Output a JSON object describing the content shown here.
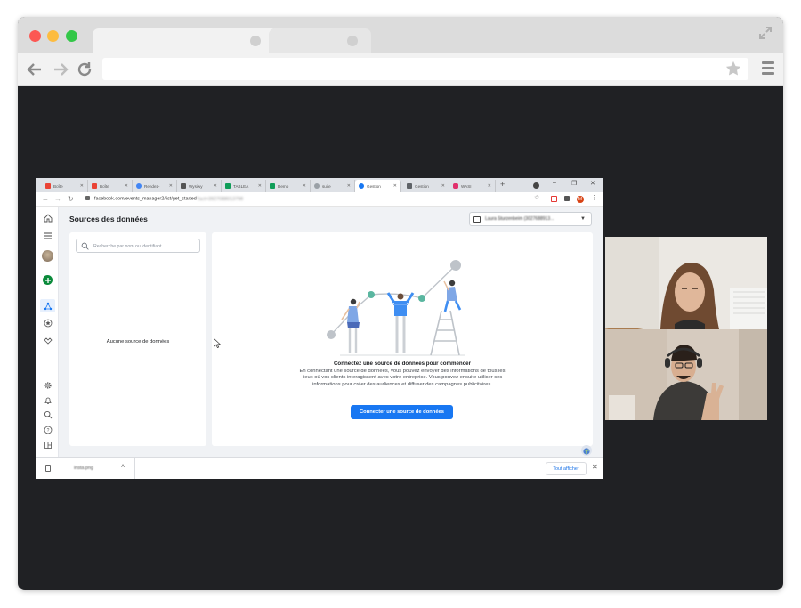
{
  "inner_browser": {
    "tabs": [
      {
        "label": "Boîte",
        "favicon": "gmail-icon",
        "color": "#ea4335",
        "active": false
      },
      {
        "label": "Boîte",
        "favicon": "gmail-icon",
        "color": "#ea4335",
        "active": false
      },
      {
        "label": "Rendez-",
        "favicon": "calendar-icon",
        "color": "#4285f4",
        "active": false
      },
      {
        "label": "Wysiwy",
        "favicon": "doc-icon",
        "color": "#555555",
        "active": false
      },
      {
        "label": "TABLEA",
        "favicon": "drive-icon",
        "color": "#0f9d58",
        "active": false
      },
      {
        "label": "Demo",
        "favicon": "sheet-icon",
        "color": "#0f9d58",
        "active": false
      },
      {
        "label": "suite",
        "favicon": "globe-icon",
        "color": "#9aa0a6",
        "active": false
      },
      {
        "label": "Gestion",
        "favicon": "facebook-icon",
        "color": "#1877f2",
        "active": true
      },
      {
        "label": "Gestion",
        "favicon": "window-icon",
        "color": "#5f6368",
        "active": false
      },
      {
        "label": "WASI",
        "favicon": "instagram-icon",
        "color": "#e1306c",
        "active": false
      }
    ],
    "new_tab": "+",
    "url_visible": "facebook.com/events_manager2/list/get_started",
    "url_blurred": "?act=3927088013798"
  },
  "page": {
    "title": "Sources des données",
    "account_blurred": "Laura Sturzenbeim (3027688913…",
    "search_placeholder": "Recherche par nom ou identifiant",
    "empty_sources": "Aucune source de données",
    "heading": "Connectez une source de données pour commencer",
    "body": "En connectant une source de données, vous pouvez envoyer des informations de tous les lieux où vos clients interagissent avec votre entreprise. Vous pouvez ensuite utiliser ces informations pour créer des audiences et diffuser des campagnes publicitaires.",
    "cta": "Connecter une source de données"
  },
  "downloads": {
    "file_name": "insta.png",
    "show_all": "Tout afficher"
  },
  "colors": {
    "accent": "#1877f2",
    "outer_bg": "#202124",
    "page_bg": "#f0f2f5"
  }
}
